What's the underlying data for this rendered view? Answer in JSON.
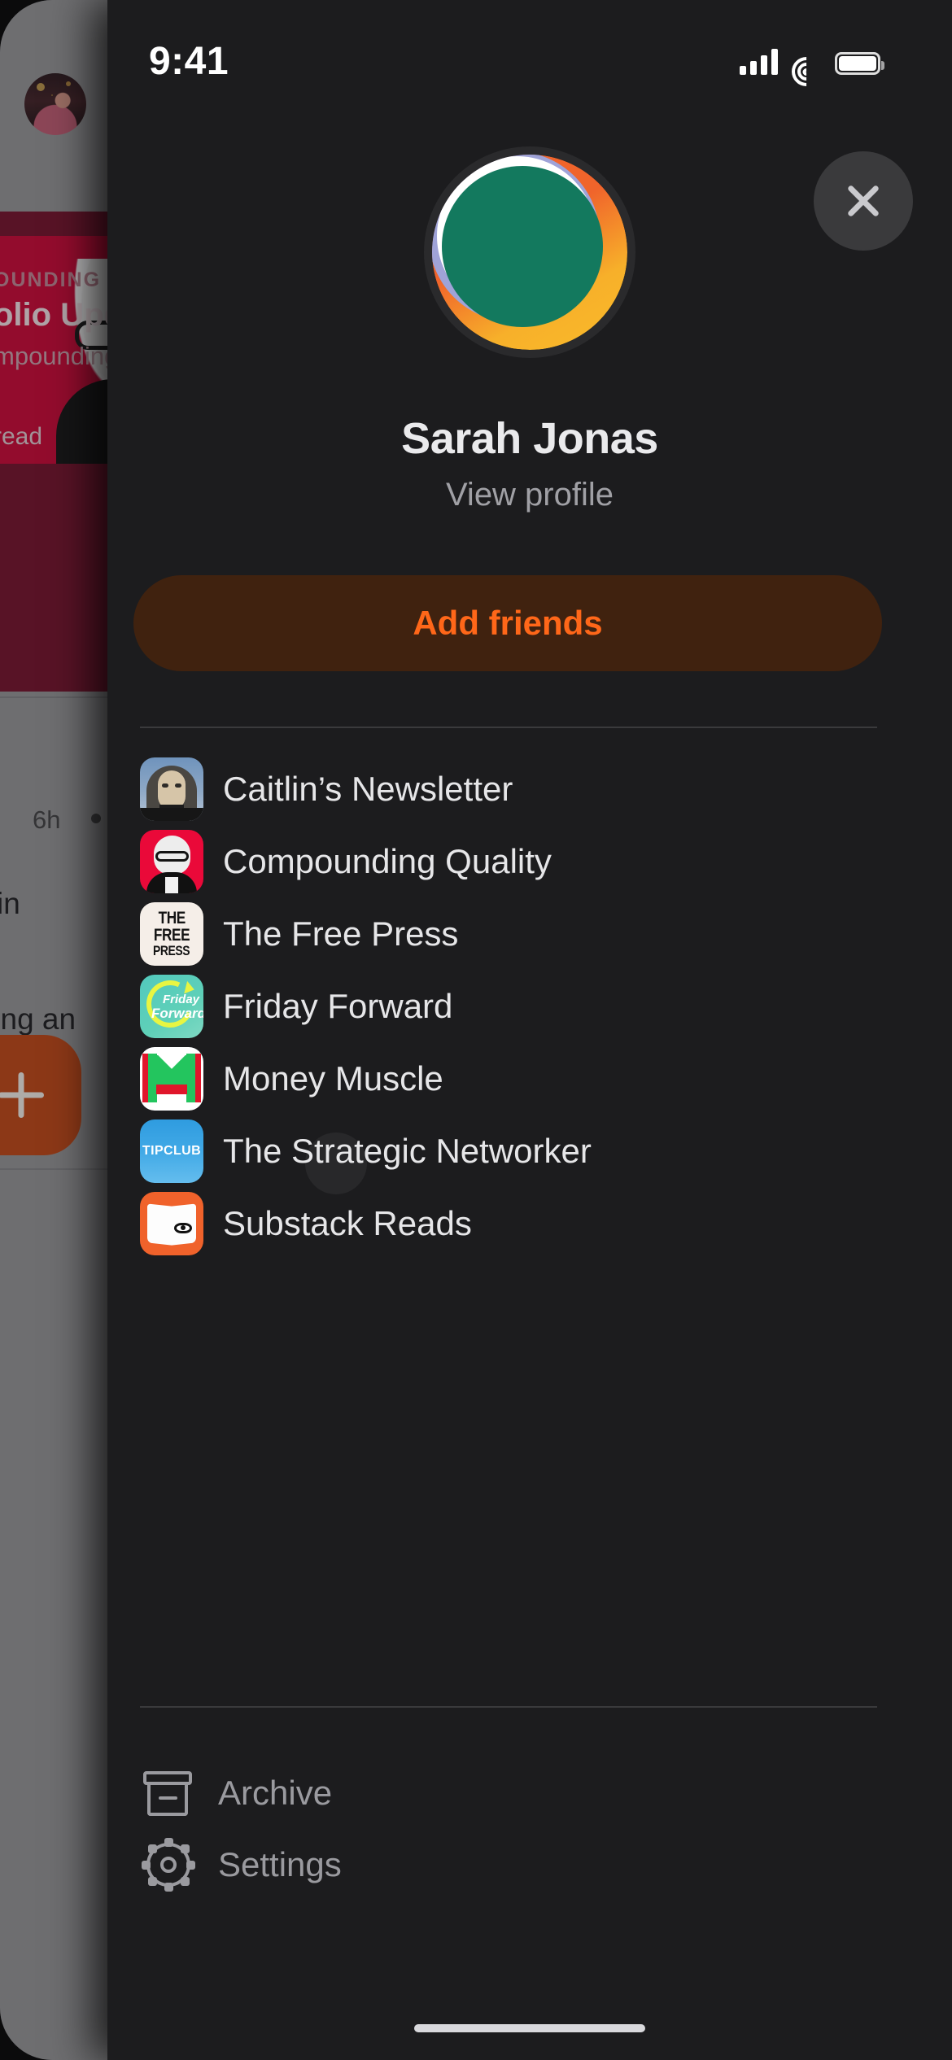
{
  "status_bar": {
    "time": "9:41",
    "cellular_icon": "cellular-signal-icon",
    "wifi_icon": "wifi-icon",
    "battery_icon": "battery-icon"
  },
  "background_screen": {
    "avatar_icon": "user-avatar",
    "post_card": {
      "kicker": "OUNDING QU",
      "title": "olio Update",
      "subtitle": "mpounding",
      "read_label": "read"
    },
    "timestamp": "6h",
    "more_icon": "ellipsis-icon",
    "text_fragment_1": "in",
    "text_fragment_2": "ting an",
    "fab_icon": "plus-icon"
  },
  "drawer": {
    "close_icon": "close-icon",
    "profile": {
      "avatar_icon": "profile-avatar",
      "name": "Sarah Jonas",
      "view_profile_label": "View profile"
    },
    "add_friends_label": "Add friends",
    "publications": [
      {
        "label": "Caitlin’s Newsletter",
        "icon": "caitlins-newsletter-icon"
      },
      {
        "label": "Compounding Quality",
        "icon": "compounding-quality-icon"
      },
      {
        "label": "The Free Press",
        "icon": "the-free-press-icon",
        "icon_text": {
          "line1": "THE",
          "line2": "FREE",
          "line3": "PRESS"
        }
      },
      {
        "label": "Friday Forward",
        "icon": "friday-forward-icon",
        "icon_text": {
          "line1": "Friday",
          "line2": "Forward"
        }
      },
      {
        "label": "Money Muscle",
        "icon": "money-muscle-icon"
      },
      {
        "label": "The Strategic Networker",
        "icon": "tipclub-icon",
        "icon_text": {
          "line1": "TIPCLUB"
        }
      },
      {
        "label": "Substack Reads",
        "icon": "substack-reads-icon"
      }
    ],
    "bottom_nav": [
      {
        "label": "Archive",
        "icon": "archive-box-icon"
      },
      {
        "label": "Settings",
        "icon": "gear-icon"
      }
    ]
  },
  "colors": {
    "accent_orange": "#FF6719",
    "button_bg": "#40220f",
    "drawer_bg": "#1c1c1e",
    "fab_orange": "#b8400f"
  }
}
